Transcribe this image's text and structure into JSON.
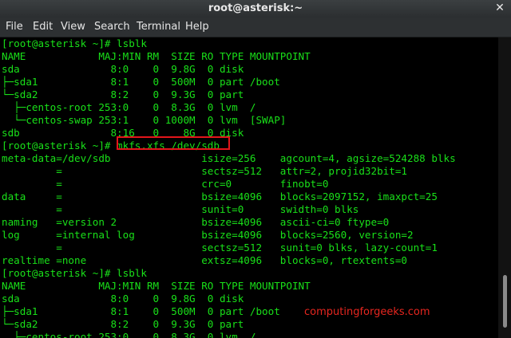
{
  "window": {
    "title": "root@asterisk:~",
    "close_glyph": "✕"
  },
  "menu": [
    "File",
    "Edit",
    "View",
    "Search",
    "Terminal",
    "Help"
  ],
  "terminal": {
    "lines": [
      "[root@asterisk ~]# lsblk",
      "NAME            MAJ:MIN RM  SIZE RO TYPE MOUNTPOINT",
      "sda               8:0    0  9.8G  0 disk",
      "├─sda1            8:1    0  500M  0 part /boot",
      "└─sda2            8:2    0  9.3G  0 part",
      "  ├─centos-root 253:0    0  8.3G  0 lvm  /",
      "  └─centos-swap 253:1    0 1000M  0 lvm  [SWAP]",
      "sdb               8:16   0    8G  0 disk",
      "[root@asterisk ~]# mkfs.xfs /dev/sdb",
      "meta-data=/dev/sdb               isize=256    agcount=4, agsize=524288 blks",
      "         =                       sectsz=512   attr=2, projid32bit=1",
      "         =                       crc=0        finobt=0",
      "data     =                       bsize=4096   blocks=2097152, imaxpct=25",
      "         =                       sunit=0      swidth=0 blks",
      "naming   =version 2              bsize=4096   ascii-ci=0 ftype=0",
      "log      =internal log           bsize=4096   blocks=2560, version=2",
      "         =                       sectsz=512   sunit=0 blks, lazy-count=1",
      "realtime =none                   extsz=4096   blocks=0, rtextents=0",
      "[root@asterisk ~]# lsblk",
      "NAME            MAJ:MIN RM  SIZE RO TYPE MOUNTPOINT",
      "sda               8:0    0  9.8G  0 disk",
      "├─sda1            8:1    0  500M  0 part /boot",
      "└─sda2            8:2    0  9.3G  0 part",
      "  ├─centos-root 253:0    0  8.3G  0 lvm  /"
    ]
  },
  "watermark": "computingforgeeks.com",
  "colors": {
    "text": "#19e019",
    "background": "#000000",
    "highlight": "#e4151a",
    "watermark": "#e6261f"
  }
}
